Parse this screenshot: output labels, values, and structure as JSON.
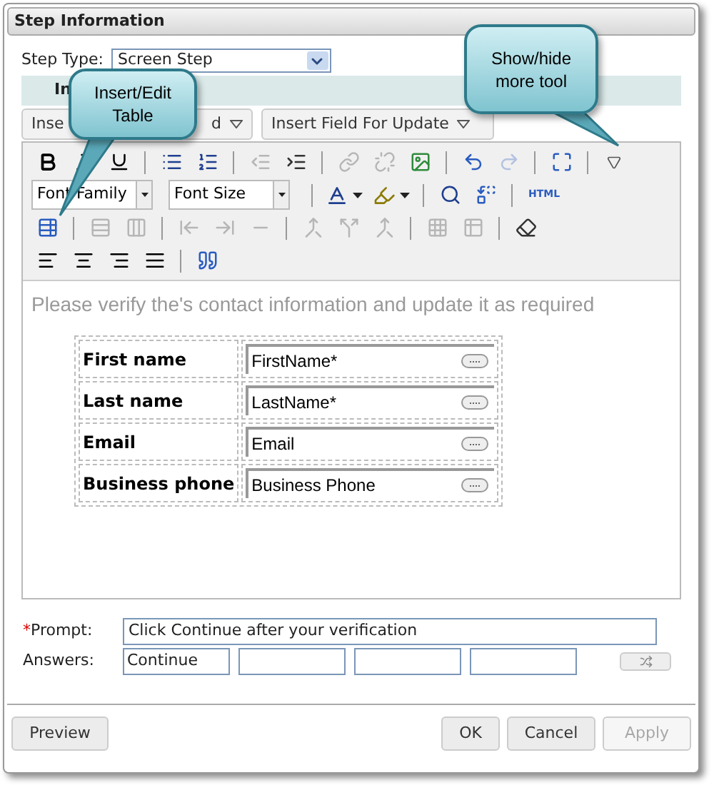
{
  "window": {
    "title": "Step Information"
  },
  "step_type": {
    "label": "Step Type:",
    "value": "Screen Step"
  },
  "tab": {
    "label": "In"
  },
  "insert_dropdowns": [
    {
      "label_start": "Inse",
      "label_end": "d"
    },
    {
      "label_start": "Insert Field For Update"
    }
  ],
  "toolbar": {
    "rows": [
      [
        {
          "kind": "button",
          "disabled": false
        },
        {
          "kind": "button",
          "disabled": false
        },
        {
          "kind": "button",
          "disabled": false
        },
        {
          "kind": "separator"
        },
        {
          "kind": "button",
          "disabled": false
        },
        {
          "kind": "button",
          "disabled": false
        },
        {
          "kind": "separator"
        },
        {
          "kind": "button",
          "disabled": true
        },
        {
          "kind": "button",
          "disabled": false
        },
        {
          "kind": "separator"
        },
        {
          "kind": "button",
          "disabled": true
        },
        {
          "kind": "button",
          "disabled": true
        },
        {
          "kind": "button",
          "disabled": false
        },
        {
          "kind": "separator"
        },
        {
          "kind": "button",
          "disabled": false
        },
        {
          "kind": "button",
          "disabled": true
        },
        {
          "kind": "separator"
        },
        {
          "kind": "button",
          "disabled": false
        },
        {
          "kind": "separator"
        },
        {
          "kind": "button",
          "disabled": false
        }
      ],
      [
        {
          "kind": "select",
          "label": "Font Family"
        },
        {
          "kind": "select",
          "label": "Font Size"
        },
        {
          "kind": "separator"
        },
        {
          "kind": "split",
          "disabled": false
        },
        {
          "kind": "split",
          "disabled": false
        },
        {
          "kind": "separator"
        },
        {
          "kind": "button",
          "disabled": false
        },
        {
          "kind": "button",
          "disabled": false
        },
        {
          "kind": "separator"
        },
        {
          "kind": "text",
          "label": "HTML"
        }
      ],
      [
        {
          "kind": "button",
          "disabled": false
        },
        {
          "kind": "separator"
        },
        {
          "kind": "button",
          "disabled": true
        },
        {
          "kind": "button",
          "disabled": true
        },
        {
          "kind": "separator"
        },
        {
          "kind": "button",
          "disabled": true
        },
        {
          "kind": "button",
          "disabled": true
        },
        {
          "kind": "button",
          "disabled": true
        },
        {
          "kind": "separator"
        },
        {
          "kind": "button",
          "disabled": true
        },
        {
          "kind": "button",
          "disabled": true
        },
        {
          "kind": "button",
          "disabled": true
        },
        {
          "kind": "separator"
        },
        {
          "kind": "button",
          "disabled": true
        },
        {
          "kind": "button",
          "disabled": true
        },
        {
          "kind": "separator"
        },
        {
          "kind": "button",
          "disabled": false
        }
      ],
      [
        {
          "kind": "button",
          "disabled": false
        },
        {
          "kind": "button",
          "disabled": false
        },
        {
          "kind": "button",
          "disabled": false
        },
        {
          "kind": "button",
          "disabled": false
        },
        {
          "kind": "separator"
        },
        {
          "kind": "button",
          "disabled": false
        }
      ]
    ]
  },
  "editor": {
    "intro": "Please verify the's contact information and update it as required",
    "rows": [
      {
        "label": "First name",
        "field": "FirstName*"
      },
      {
        "label": "Last name",
        "field": "LastName*"
      },
      {
        "label": "Email",
        "field": "Email"
      },
      {
        "label": "Business phone",
        "field": "Business Phone"
      }
    ]
  },
  "prompt": {
    "label": "Prompt:",
    "required_mark": "*",
    "value": "Click Continue after your verification"
  },
  "answers": {
    "label": "Answers:",
    "values": [
      "Continue"
    ]
  },
  "buttons": [
    {
      "label": "Preview",
      "disabled": false
    },
    {
      "label": "OK",
      "disabled": false
    },
    {
      "label": "Cancel",
      "disabled": false
    },
    {
      "label": "Apply",
      "disabled": true
    }
  ],
  "callouts": [
    {
      "text": "Insert/Edit Table"
    },
    {
      "text": "Show/hide more tool"
    }
  ]
}
